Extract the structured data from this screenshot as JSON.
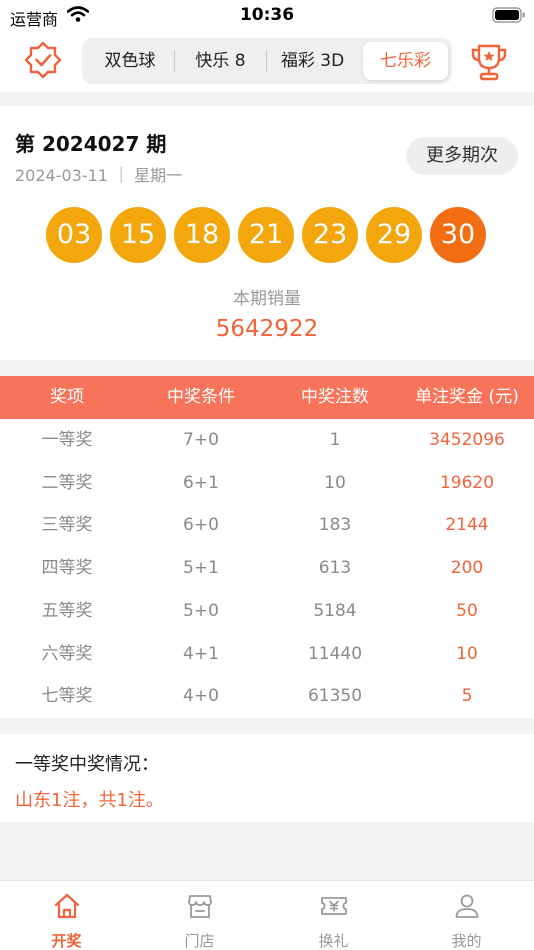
{
  "status_bar": {
    "carrier": "运营商",
    "time": "10:36"
  },
  "header": {
    "tabs": [
      {
        "label": "双色球",
        "active": false
      },
      {
        "label": "快乐 8",
        "active": false
      },
      {
        "label": "福彩 3D",
        "active": false
      },
      {
        "label": "七乐彩",
        "active": true
      }
    ],
    "left_icon": "badge-check-icon",
    "right_icon": "trophy-icon"
  },
  "draw": {
    "issue": "第 2024027 期",
    "date": "2024-03-11 ｜ 星期一",
    "more_button": "更多期次",
    "balls": [
      "03",
      "15",
      "18",
      "21",
      "23",
      "29",
      "30"
    ],
    "special_ball_index": 6,
    "sales_label": "本期销量",
    "sales_value": "5642922"
  },
  "prize_table": {
    "headers": [
      "奖项",
      "中奖条件",
      "中奖注数",
      "单注奖金 (元)"
    ],
    "rows": [
      [
        "一等奖",
        "7+0",
        "1",
        "3452096"
      ],
      [
        "二等奖",
        "6+1",
        "10",
        "19620"
      ],
      [
        "三等奖",
        "6+0",
        "183",
        "2144"
      ],
      [
        "四等奖",
        "5+1",
        "613",
        "200"
      ],
      [
        "五等奖",
        "5+0",
        "5184",
        "50"
      ],
      [
        "六等奖",
        "4+1",
        "11440",
        "10"
      ],
      [
        "七等奖",
        "4+0",
        "61350",
        "5"
      ]
    ]
  },
  "winners": {
    "title": "一等奖中奖情况：",
    "text": "山东1注，共1注。"
  },
  "tabbar": {
    "items": [
      {
        "label": "开奖",
        "icon": "home-icon",
        "active": true
      },
      {
        "label": "门店",
        "icon": "store-icon",
        "active": false
      },
      {
        "label": "换礼",
        "icon": "gift-ticket-icon",
        "active": false
      },
      {
        "label": "我的",
        "icon": "user-icon",
        "active": false
      }
    ]
  },
  "colors": {
    "accent": "#f0643c",
    "ball": "#f3a70c",
    "special_ball": "#f36d12",
    "table_header": "#f7735a"
  }
}
